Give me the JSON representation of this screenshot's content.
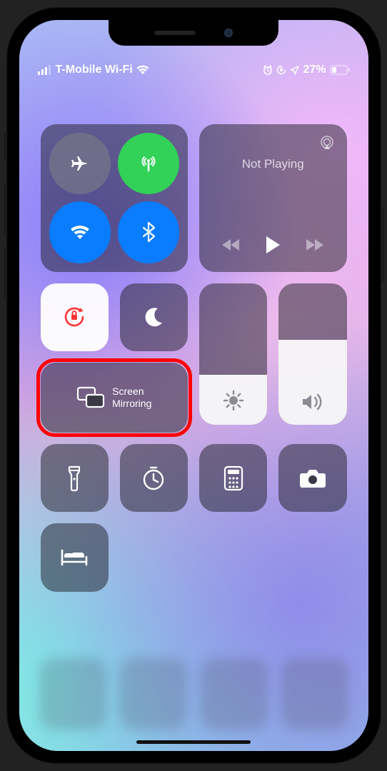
{
  "statusbar": {
    "carrier": "T-Mobile Wi-Fi",
    "battery_percent": "27%"
  },
  "media": {
    "now_playing": "Not Playing"
  },
  "screen_mirroring": {
    "label_line1": "Screen",
    "label_line2": "Mirroring"
  },
  "sliders": {
    "brightness_percent": 35,
    "volume_percent": 60
  },
  "highlight": {
    "target": "screen-mirroring-button"
  },
  "colors": {
    "active_green": "#32d158",
    "active_blue": "#0a7cff",
    "highlight_red": "#f00"
  },
  "toggles": {
    "airplane": false,
    "cellular": true,
    "wifi": true,
    "bluetooth": true,
    "orientation_lock": true,
    "do_not_disturb": false
  }
}
